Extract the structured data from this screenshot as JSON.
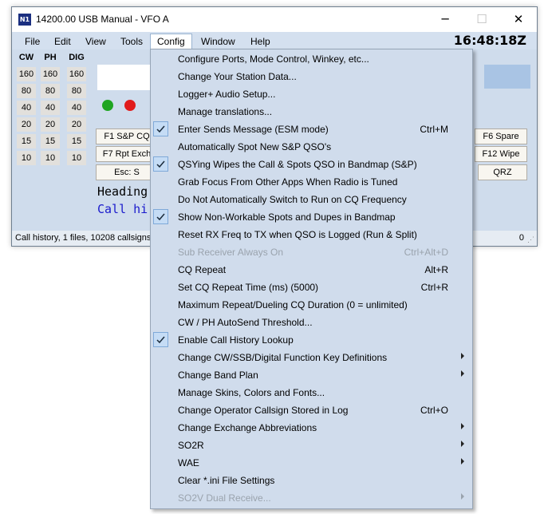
{
  "window": {
    "title": "14200.00 USB Manual - VFO A",
    "icon_label": "N1",
    "controls": {
      "minimize": "─",
      "maximize": "☐",
      "close": "✕"
    }
  },
  "menubar": {
    "items": [
      "File",
      "Edit",
      "View",
      "Tools",
      "Config",
      "Window",
      "Help"
    ],
    "clock": "16:48:18Z"
  },
  "bands": {
    "headers": [
      "CW",
      "PH",
      "DIG"
    ],
    "values": [
      "160",
      "80",
      "40",
      "20",
      "15",
      "10"
    ]
  },
  "leds": [
    "#1fa521",
    "#e11b1b"
  ],
  "function_keys": {
    "f1": "F1 S&P CQ",
    "f7": "F7 Rpt Exch",
    "esc": "Esc: S",
    "f6": "F6 Spare",
    "f12": "F12 Wipe",
    "qrz": "QRZ"
  },
  "log_lines": {
    "heading": "Heading",
    "call_history": "Call hi"
  },
  "status": {
    "text": "Call history, 1 files, 10208 callsigns",
    "right": "0"
  },
  "config_menu": {
    "items": [
      {
        "label": "Configure Ports, Mode Control, Winkey, etc...",
        "shortcut": "",
        "checked": false,
        "submenu": false,
        "disabled": false
      },
      {
        "label": "Change Your Station Data...",
        "shortcut": "",
        "checked": false,
        "submenu": false,
        "disabled": false
      },
      {
        "label": "Logger+ Audio Setup...",
        "shortcut": "",
        "checked": false,
        "submenu": false,
        "disabled": false
      },
      {
        "label": "Manage translations...",
        "shortcut": "",
        "checked": false,
        "submenu": false,
        "disabled": false
      },
      {
        "label": "Enter Sends Message (ESM mode)",
        "shortcut": "Ctrl+M",
        "checked": true,
        "submenu": false,
        "disabled": false
      },
      {
        "label": "Automatically Spot New S&P QSO's",
        "shortcut": "",
        "checked": false,
        "submenu": false,
        "disabled": false
      },
      {
        "label": "QSYing Wipes the Call & Spots QSO in Bandmap (S&P)",
        "shortcut": "",
        "checked": true,
        "submenu": false,
        "disabled": false
      },
      {
        "label": "Grab Focus From Other Apps When Radio is Tuned",
        "shortcut": "",
        "checked": false,
        "submenu": false,
        "disabled": false
      },
      {
        "label": "Do Not Automatically Switch to Run on CQ Frequency",
        "shortcut": "",
        "checked": false,
        "submenu": false,
        "disabled": false
      },
      {
        "label": "Show Non-Workable Spots and Dupes in Bandmap",
        "shortcut": "",
        "checked": true,
        "submenu": false,
        "disabled": false
      },
      {
        "label": "Reset RX Freq to TX when QSO is Logged (Run & Split)",
        "shortcut": "",
        "checked": false,
        "submenu": false,
        "disabled": false
      },
      {
        "label": "Sub Receiver Always On",
        "shortcut": "Ctrl+Alt+D",
        "checked": false,
        "submenu": false,
        "disabled": true
      },
      {
        "label": "CQ Repeat",
        "shortcut": "Alt+R",
        "checked": false,
        "submenu": false,
        "disabled": false
      },
      {
        "label": "Set CQ Repeat Time (ms) (5000)",
        "shortcut": "Ctrl+R",
        "checked": false,
        "submenu": false,
        "disabled": false
      },
      {
        "label": "Maximum Repeat/Dueling CQ Duration (0 = unlimited)",
        "shortcut": "",
        "checked": false,
        "submenu": false,
        "disabled": false
      },
      {
        "label": "CW / PH AutoSend Threshold...",
        "shortcut": "",
        "checked": false,
        "submenu": false,
        "disabled": false
      },
      {
        "label": "Enable Call History Lookup",
        "shortcut": "",
        "checked": true,
        "submenu": false,
        "disabled": false
      },
      {
        "label": "Change CW/SSB/Digital Function Key Definitions",
        "shortcut": "",
        "checked": false,
        "submenu": true,
        "disabled": false
      },
      {
        "label": "Change Band Plan",
        "shortcut": "",
        "checked": false,
        "submenu": true,
        "disabled": false
      },
      {
        "label": "Manage Skins, Colors and Fonts...",
        "shortcut": "",
        "checked": false,
        "submenu": false,
        "disabled": false
      },
      {
        "label": "Change Operator Callsign Stored in Log",
        "shortcut": "Ctrl+O",
        "checked": false,
        "submenu": false,
        "disabled": false
      },
      {
        "label": "Change Exchange Abbreviations",
        "shortcut": "",
        "checked": false,
        "submenu": true,
        "disabled": false
      },
      {
        "label": "SO2R",
        "shortcut": "",
        "checked": false,
        "submenu": true,
        "disabled": false
      },
      {
        "label": "WAE",
        "shortcut": "",
        "checked": false,
        "submenu": true,
        "disabled": false
      },
      {
        "label": "Clear *.ini File Settings",
        "shortcut": "",
        "checked": false,
        "submenu": false,
        "disabled": false
      },
      {
        "label": "SO2V Dual Receive...",
        "shortcut": "",
        "checked": false,
        "submenu": true,
        "disabled": true
      }
    ]
  }
}
